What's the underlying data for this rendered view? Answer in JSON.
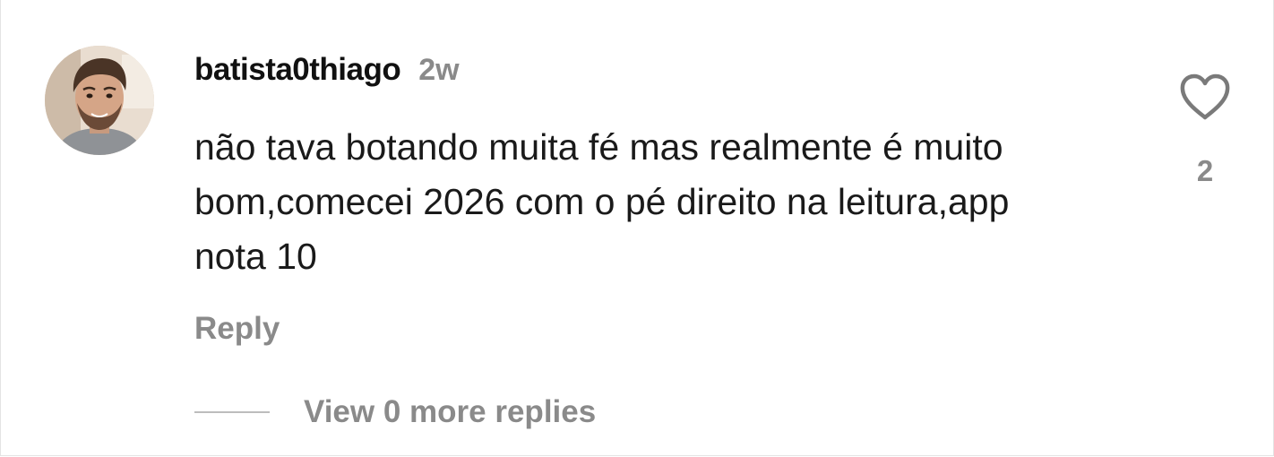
{
  "comment": {
    "username": "batista0thiago",
    "time_ago": "2w",
    "text": "não tava botando muita fé mas realmente é muito bom,comecei 2026 com o pé direito na leitura,app nota 10",
    "reply_label": "Reply",
    "view_replies_label": "View 0 more replies",
    "like_count": "2"
  },
  "icons": {
    "like": "heart-outline-icon",
    "avatar": "user-avatar-photo"
  },
  "colors": {
    "username": "#111111",
    "secondary_text": "#8a8a8a",
    "divider_line": "#bdbdbd",
    "heart_stroke": "#7a7a7a",
    "background": "#ffffff"
  }
}
